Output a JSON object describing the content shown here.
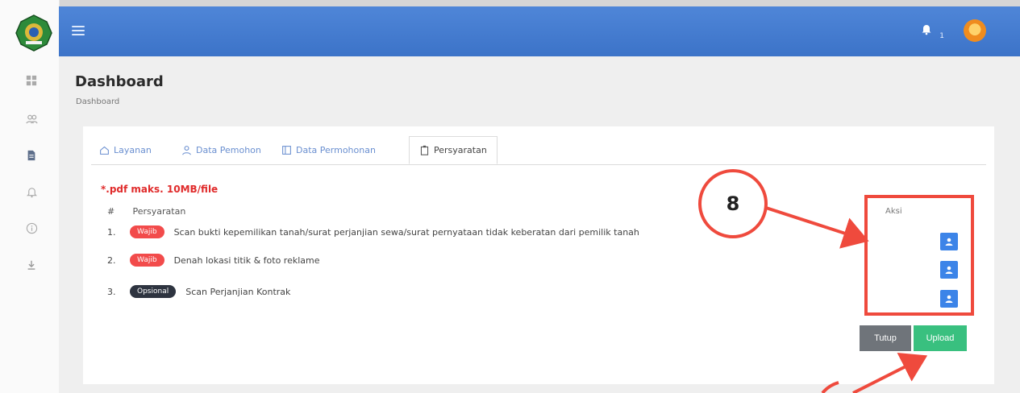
{
  "header": {
    "notification_count": "1"
  },
  "page": {
    "title": "Dashboard",
    "breadcrumb": "Dashboard"
  },
  "tabs": [
    {
      "label": "Layanan",
      "icon": "home-icon"
    },
    {
      "label": "Data Pemohon",
      "icon": "user-icon"
    },
    {
      "label": "Data Permohonan",
      "icon": "document-icon"
    },
    {
      "label": "Persyaratan",
      "icon": "clipboard-icon"
    }
  ],
  "form": {
    "note": "*.pdf maks. 10MB/file",
    "columns": {
      "number": "#",
      "requirement": "Persyaratan",
      "action": "Aksi"
    },
    "rows": [
      {
        "number": "1.",
        "badge": "Wajib",
        "text": "Scan bukti kepemilikan tanah/surat perjanjian sewa/surat pernyataan tidak keberatan dari pemilik tanah"
      },
      {
        "number": "2.",
        "badge": "Wajib",
        "text": "Denah lokasi titik & foto reklame"
      },
      {
        "number": "3.",
        "badge": "Opsional",
        "text": "Scan Perjanjian Kontrak"
      }
    ],
    "buttons": {
      "close": "Tutup",
      "upload": "Upload"
    }
  },
  "annotation": {
    "label": "8",
    "color": "#ef4a3d"
  },
  "colors": {
    "topbar": "#3c73c8",
    "required_badge": "#f24b4b",
    "optional_badge": "#2e3440",
    "upload_action": "#3c84e8",
    "close_button": "#6f747a",
    "upload_button": "#39c07f"
  }
}
